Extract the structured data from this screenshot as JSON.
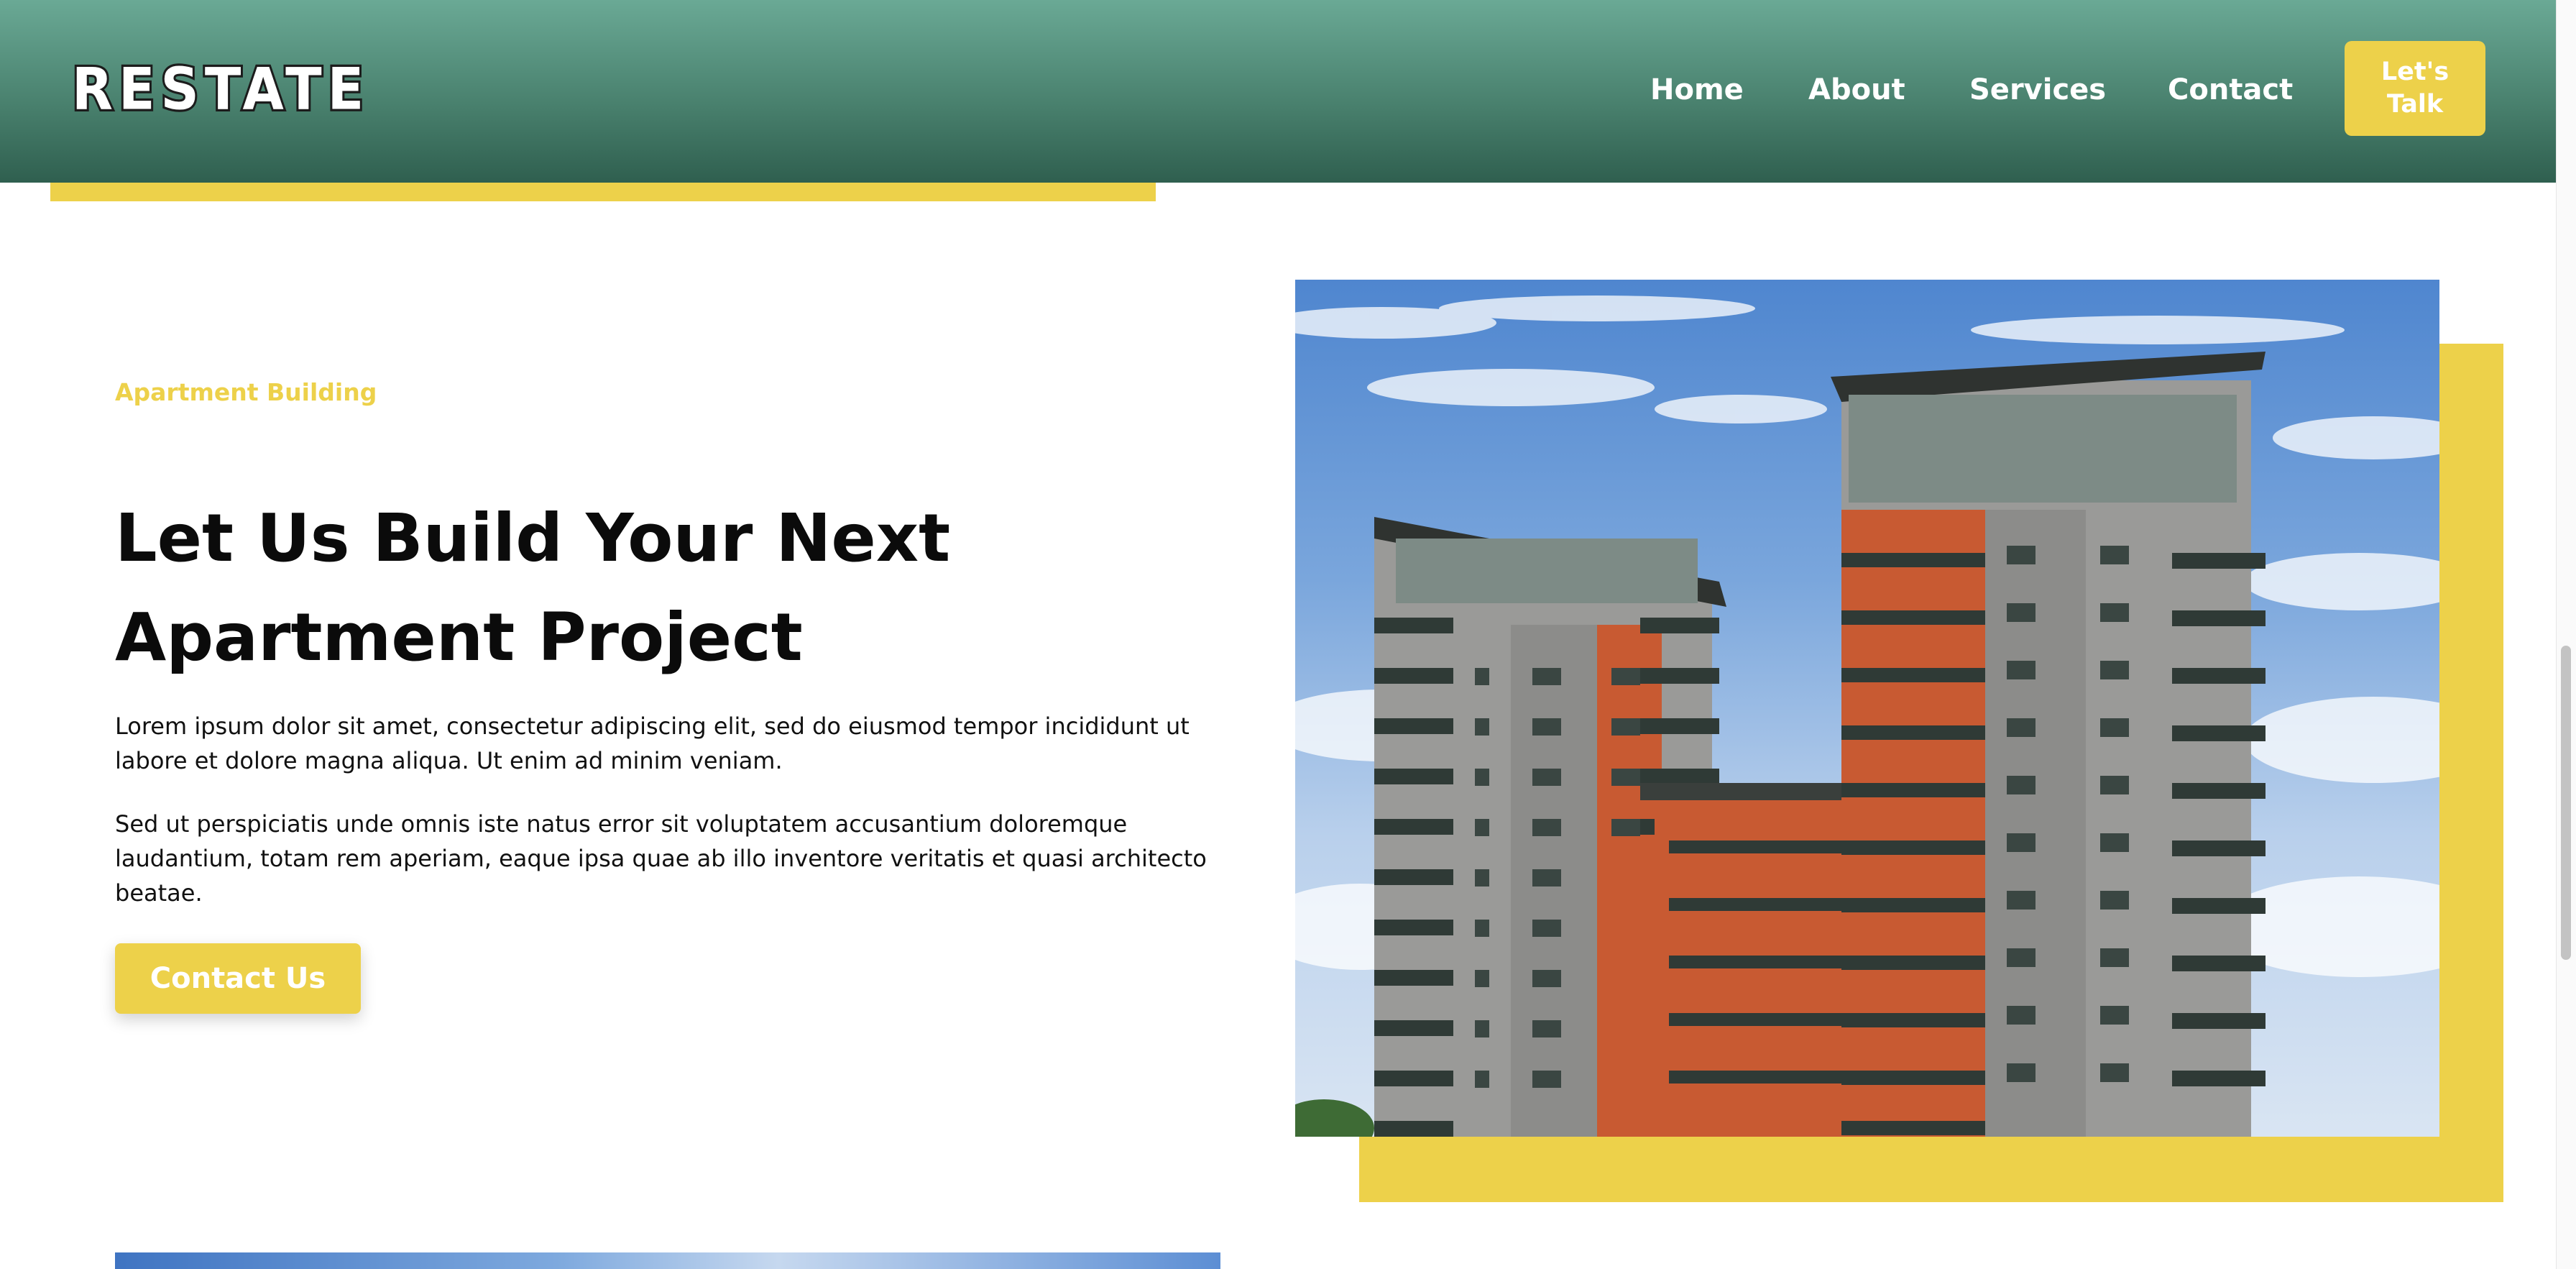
{
  "header": {
    "logo_text": "RESTATE",
    "nav": [
      {
        "label": "Home"
      },
      {
        "label": "About"
      },
      {
        "label": "Services"
      },
      {
        "label": "Contact"
      }
    ],
    "cta_line1": "Let's",
    "cta_line2": "Talk"
  },
  "hero": {
    "eyebrow": "Apartment Building",
    "title_line1": "Let Us Build Your Next",
    "title_line2": "Apartment Project",
    "paragraph1": "Lorem ipsum dolor sit amet, consectetur adipiscing elit, sed do eiusmod tempor incididunt ut labore et dolore magna aliqua. Ut enim ad minim veniam.",
    "paragraph2": "Sed ut perspiciatis unde omnis iste natus error sit voluptatem accusantium doloremque laudantium, totam rem aperiam, eaque ipsa quae ab illo inventore veritatis et quasi architecto beatae.",
    "button_label": "Contact Us"
  },
  "colors": {
    "accent_yellow": "#edd14a",
    "header_green_top": "#6aa995",
    "header_green_bottom": "#2f5f4f",
    "text_dark": "#0b0b0b"
  }
}
